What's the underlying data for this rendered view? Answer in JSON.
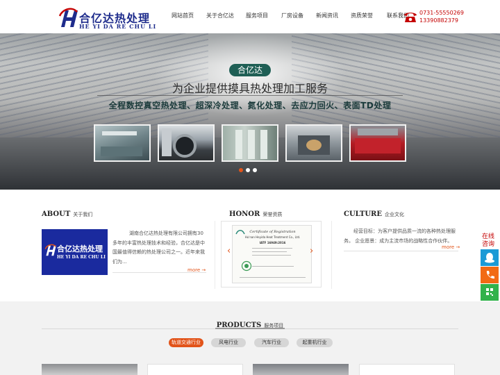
{
  "header": {
    "logo_cn": "合亿达热处理",
    "logo_en": "HE YI DA RE CHU LI",
    "nav": [
      "网站首页",
      "关于合亿达",
      "服务项目",
      "厂房设备",
      "新闻资讯",
      "资质荣誉",
      "联系我们"
    ],
    "phones": [
      "0731-55550269",
      "13390882379"
    ]
  },
  "banner": {
    "badge": "合亿达",
    "line1": "为企业提供摸具热处理加工服务",
    "line2": "全程数控真空热处理、超深冷处理、氮化处理、去应力回火、表面TD处理",
    "slide_count": 3,
    "active_slide": 1
  },
  "about": {
    "title_en": "ABOUT",
    "title_cn": "关于我们",
    "image_cn": "合亿达热处理",
    "image_en": "HE YI DA RE CHU LI",
    "text": "湖南合亿达热处理有限公司拥有30多年的丰富热处理技术和经验，合亿达是中国最值得信赖的热处理公司之一。近年来我们为...",
    "more": "more →"
  },
  "honor": {
    "title_en": "HONOR",
    "title_cn": "荣誉资质",
    "cert_title": "Certificate of Registration",
    "cert_company": "Hu'nan Heyida Heat Treatment Co., Ltd.",
    "cert_std": "IATF 16949:2016",
    "prev": "‹",
    "next": "›"
  },
  "culture": {
    "title_en": "CULTURE",
    "title_cn": "企业文化",
    "text": "经营目标：为客户提供品质一流的各种热处理服务。 企业愿景：成为主流市场的战略性合作伙伴。",
    "more": "more →"
  },
  "side": {
    "label": "在线咨询",
    "up": "︿"
  },
  "products": {
    "title_en": "PRODUCTS",
    "title_cn": "服务项目",
    "tabs": [
      "轨道交通行业",
      "风电行业",
      "汽车行业",
      "起重机行业"
    ],
    "active_tab": 0
  },
  "colors": {
    "accent": "#e2541a",
    "brand_blue": "#1e2c8c",
    "phone_red": "#c40000"
  }
}
